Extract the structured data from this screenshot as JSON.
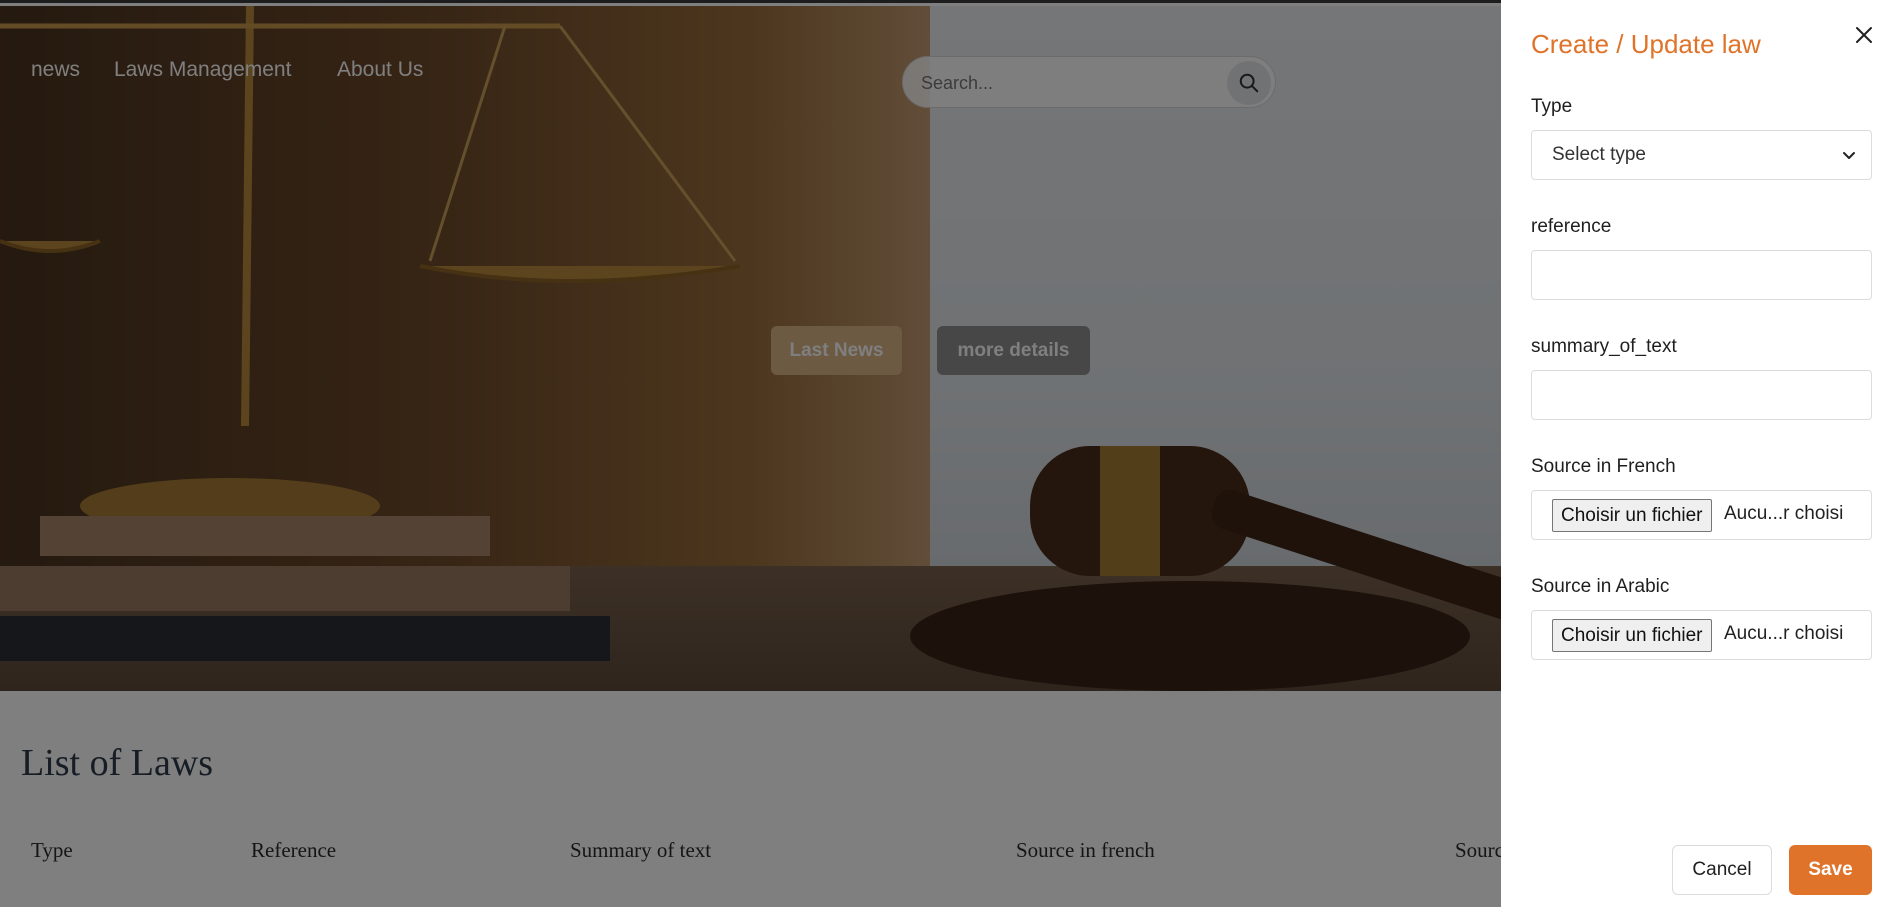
{
  "navbar": {
    "links": [
      "news",
      "Laws Management",
      "About Us"
    ],
    "search_placeholder": "Search..."
  },
  "hero": {
    "buttons": [
      "Last News",
      "more details"
    ]
  },
  "list": {
    "title": "List of Laws",
    "columns": [
      "Type",
      "Reference",
      "Summary of text",
      "Source in french",
      "Source in arabic"
    ]
  },
  "panel": {
    "title": "Create / Update law",
    "fields": {
      "type": {
        "label": "Type",
        "value": "Select type"
      },
      "reference": {
        "label": "reference",
        "value": ""
      },
      "summary": {
        "label": "summary_of_text",
        "value": ""
      },
      "source_fr": {
        "label": "Source in French",
        "button": "Choisir un fichier",
        "status": "Aucu...r choisi"
      },
      "source_ar": {
        "label": "Source in Arabic",
        "button": "Choisir un fichier",
        "status": "Aucu...r choisi"
      }
    },
    "cancel_label": "Cancel",
    "save_label": "Save"
  },
  "colors": {
    "accent": "#e0732a",
    "overlay": "rgba(0,0,0,0.5)"
  },
  "icons": [
    "search-icon",
    "close-icon",
    "chevron-down-icon"
  ]
}
